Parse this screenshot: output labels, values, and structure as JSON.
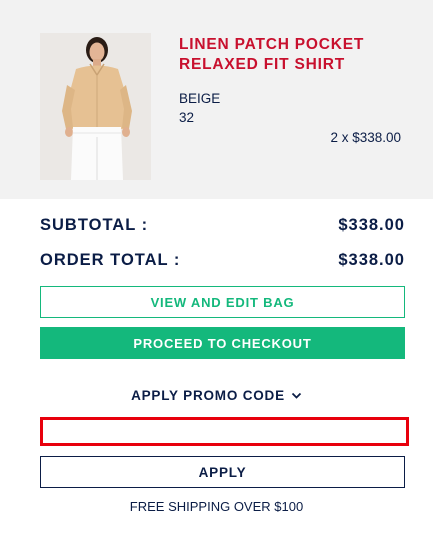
{
  "item": {
    "name": "LINEN PATCH POCKET RELAXED FIT SHIRT",
    "color": "BEIGE",
    "size": "32",
    "qty_price": "2 x $338.00",
    "image_icon": "product-photo-woman-beige-shirt-white-jeans"
  },
  "totals": {
    "subtotal_label": "SUBTOTAL :",
    "subtotal_value": "$338.00",
    "order_total_label": "ORDER TOTAL :",
    "order_total_value": "$338.00"
  },
  "actions": {
    "view_edit_label": "VIEW AND EDIT BAG",
    "checkout_label": "PROCEED TO CHECKOUT"
  },
  "promo": {
    "toggle_label": "APPLY PROMO CODE",
    "toggle_icon": "chevron-down-icon",
    "input_value": "",
    "apply_label": "APPLY"
  },
  "shipping_note": "FREE SHIPPING OVER $100",
  "colors": {
    "navy": "#0b1d46",
    "red": "#c8102e",
    "green": "#14b87c",
    "error_border": "#e8000c",
    "panel_bg": "#f2f2f2"
  }
}
